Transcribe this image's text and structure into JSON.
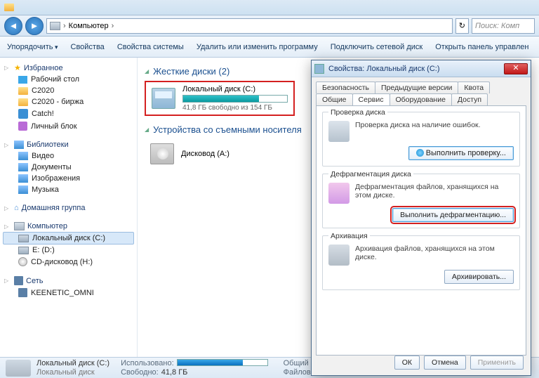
{
  "titlebar": {
    "app": ""
  },
  "address": {
    "location": "Компьютер",
    "chevron": "›",
    "search_placeholder": "Поиск: Комп"
  },
  "toolbar": {
    "organize": "Упорядочить",
    "properties": "Свойства",
    "system_properties": "Свойства системы",
    "uninstall": "Удалить или изменить программу",
    "map_drive": "Подключить сетевой диск",
    "open_panel": "Открыть панель управлен"
  },
  "sidebar": {
    "favorites": {
      "label": "Избранное",
      "items": [
        {
          "label": "Рабочий стол",
          "icon": "desk"
        },
        {
          "label": "C2020",
          "icon": "folder"
        },
        {
          "label": "C2020 - биржа",
          "icon": "folder"
        },
        {
          "label": "Catch!",
          "icon": "blue"
        },
        {
          "label": "Личный блок",
          "icon": "purple"
        }
      ]
    },
    "libraries": {
      "label": "Библиотеки",
      "items": [
        {
          "label": "Видео",
          "icon": "lib"
        },
        {
          "label": "Документы",
          "icon": "lib"
        },
        {
          "label": "Изображения",
          "icon": "lib"
        },
        {
          "label": "Музыка",
          "icon": "lib"
        }
      ]
    },
    "homegroup": {
      "label": "Домашняя группа"
    },
    "computer": {
      "label": "Компьютер",
      "items": [
        {
          "label": "Локальный диск (C:)",
          "icon": "drive"
        },
        {
          "label": "E: (D:)",
          "icon": "drive"
        },
        {
          "label": "CD-дисковод (H:)",
          "icon": "cd"
        }
      ]
    },
    "network": {
      "label": "Сеть",
      "items": [
        {
          "label": "KEENETIC_OMNI",
          "icon": "net"
        }
      ]
    }
  },
  "content": {
    "hdd_header": "Жесткие диски (2)",
    "local_disk": {
      "title": "Локальный диск (C:)",
      "free": "41,8 ГБ свободно из 154 ГБ"
    },
    "removable_header": "Устройства со съемными носителя",
    "dvd": {
      "title": "Дисковод (A:)"
    }
  },
  "status": {
    "title": "Локальный диск (C:)",
    "subtitle": "Локальный диск",
    "used_label": "Использовано:",
    "free_label": "Свободно:",
    "free_value": "41,8 ГБ",
    "total_label": "Общий",
    "fs_label": "Файловая"
  },
  "dialog": {
    "title": "Свойства: Локальный диск (C:)",
    "tabs_row1": [
      "Безопасность",
      "Предыдущие версии",
      "Квота"
    ],
    "tabs_row2": [
      "Общие",
      "Сервис",
      "Оборудование",
      "Доступ"
    ],
    "active_tab": "Сервис",
    "check": {
      "legend": "Проверка диска",
      "text": "Проверка диска на наличие ошибок.",
      "button": "Выполнить проверку..."
    },
    "defrag": {
      "legend": "Дефрагментация диска",
      "text": "Дефрагментация файлов, хранящихся на этом диске.",
      "button": "Выполнить дефрагментацию..."
    },
    "backup": {
      "legend": "Архивация",
      "text": "Архивация файлов, хранящихся на этом диске.",
      "button": "Архивировать..."
    },
    "ok": "ОК",
    "cancel": "Отмена",
    "apply": "Применить"
  }
}
